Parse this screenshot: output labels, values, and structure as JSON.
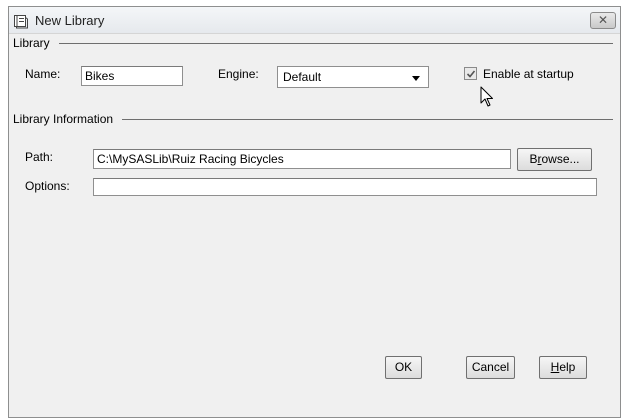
{
  "window": {
    "title": "New Library",
    "close_symbol": "✕"
  },
  "library_group": {
    "label": "Library",
    "name_label": "Name:",
    "name_value": "Bikes",
    "engine_label": "Engine:",
    "engine_value": "Default",
    "enable_label": "Enable at startup",
    "enable_checked": true
  },
  "info_group": {
    "label": "Library Information",
    "path_label": "Path:",
    "path_value": "C:\\MySASLib\\Ruiz Racing Bicycles",
    "browse_pre": "B",
    "browse_ul": "r",
    "browse_post": "owse...",
    "options_label": "Options:",
    "options_value": ""
  },
  "buttons": {
    "ok": "OK",
    "cancel": "Cancel",
    "help_ul": "H",
    "help_post": "elp"
  },
  "icons": {
    "title": "library-book-icon",
    "cursor": "mouse-pointer-icon"
  },
  "colors": {
    "window_bg": "#f0f0f0",
    "border": "#8e8f8f"
  }
}
